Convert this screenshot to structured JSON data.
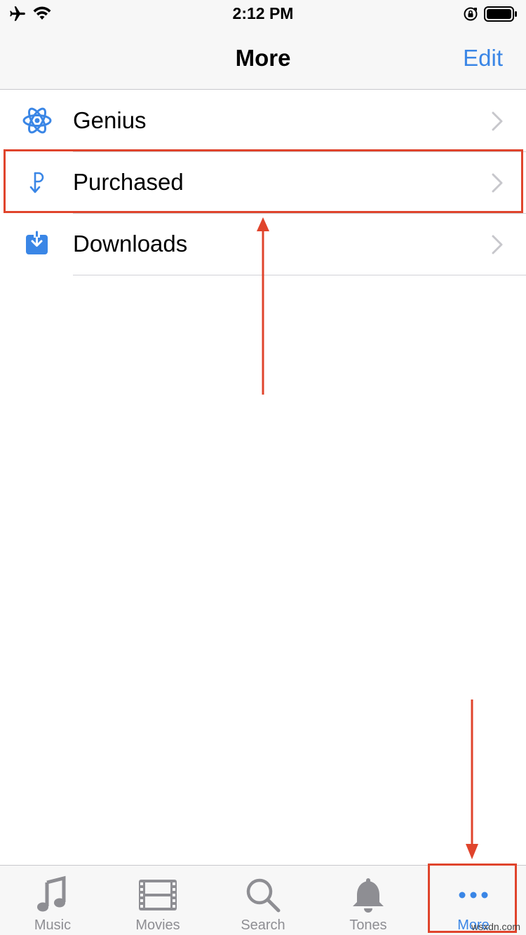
{
  "status_bar": {
    "time": "2:12 PM"
  },
  "nav": {
    "title": "More",
    "edit_label": "Edit"
  },
  "list": {
    "items": [
      {
        "label": "Genius",
        "icon": "atom-icon"
      },
      {
        "label": "Purchased",
        "icon": "purchased-arrow-icon"
      },
      {
        "label": "Downloads",
        "icon": "download-tray-icon"
      }
    ]
  },
  "tabs": [
    {
      "label": "Music",
      "icon": "music-note-icon"
    },
    {
      "label": "Movies",
      "icon": "film-strip-icon"
    },
    {
      "label": "Search",
      "icon": "magnifier-icon"
    },
    {
      "label": "Tones",
      "icon": "bell-icon"
    },
    {
      "label": "More",
      "icon": "ellipsis-icon",
      "selected": true
    }
  ],
  "colors": {
    "accent": "#3a86e6",
    "annotation": "#e0442c",
    "inactive": "#8e8e93"
  },
  "watermark": "wsxdn.com"
}
